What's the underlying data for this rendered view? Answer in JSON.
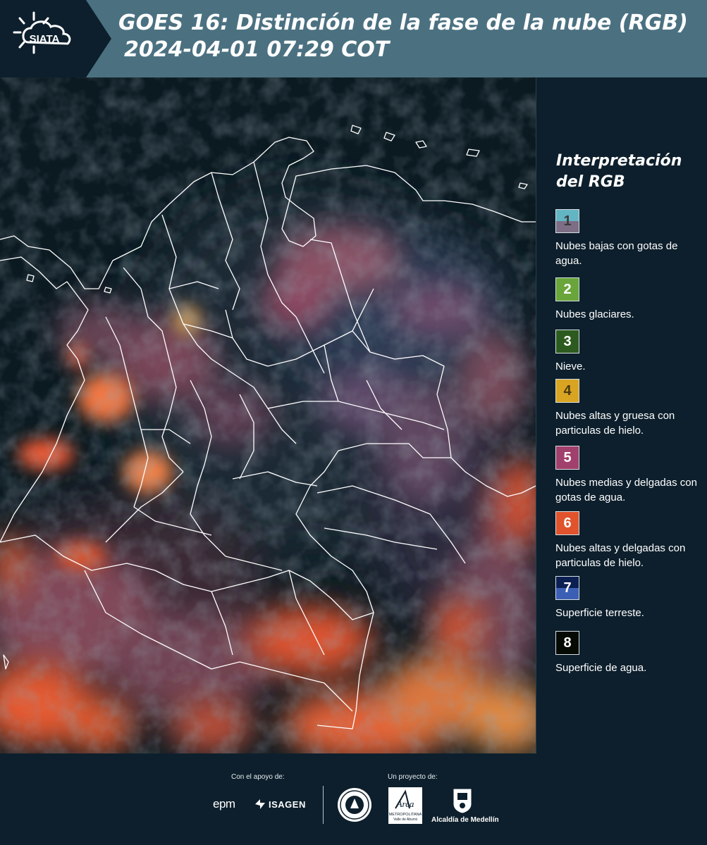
{
  "header": {
    "logo_text": "SIATA",
    "title_line1": "GOES 16: Distinción de la fase de la nube (RGB)",
    "title_line2": "2024-04-01 07:29 COT"
  },
  "legend": {
    "title": "Interpretación del RGB",
    "items": [
      {
        "number": "1",
        "label": "Nubes bajas con gotas de agua.",
        "color_top": "#63b5c4",
        "color_bottom": "#7d6e85",
        "num_color": "#3a3a3a"
      },
      {
        "number": "2",
        "label": "Nubes glaciares.",
        "color": "#69a53a",
        "num_color": "#ffffff"
      },
      {
        "number": "3",
        "label": "Nieve.",
        "color": "#2d5b1f",
        "num_color": "#ffffff"
      },
      {
        "number": "4",
        "label": "Nubes altas y gruesa con particulas de hielo.",
        "color": "#d9a421",
        "num_color": "#4a3a10"
      },
      {
        "number": "5",
        "label": "Nubes medias y delgadas con gotas de agua.",
        "color": "#a1406c",
        "num_color": "#ffffff"
      },
      {
        "number": "6",
        "label": "Nubes altas y delgadas con particulas de hielo.",
        "color": "#e0532c",
        "num_color": "#ffffff"
      },
      {
        "number": "7",
        "label": "Superficie terreste.",
        "color_top": "#0b1f52",
        "color_bottom": "#3a5fb4",
        "num_color": "#ffffff"
      },
      {
        "number": "8",
        "label": "Superficie de agua.",
        "color": "#050a05",
        "num_color": "#ffffff"
      }
    ]
  },
  "footer": {
    "support_caption": "Con el apoyo de:",
    "project_caption": "Un proyecto de:",
    "sponsor_epm": "epm",
    "sponsor_isagen": "ISAGEN",
    "partner_area_main": "Área",
    "partner_area_sub": "METROPOLITANA",
    "partner_area_sub2": "Valle de Aburrá",
    "partner_alcaldia": "Alcaldía de Medellín"
  },
  "colors": {
    "header_bg": "#4b7181",
    "logo_panel_bg": "#0d1f2c",
    "page_bg": "#0d1f2c",
    "cloud_red": "#e2522c",
    "cloud_pink": "#b4607a"
  }
}
